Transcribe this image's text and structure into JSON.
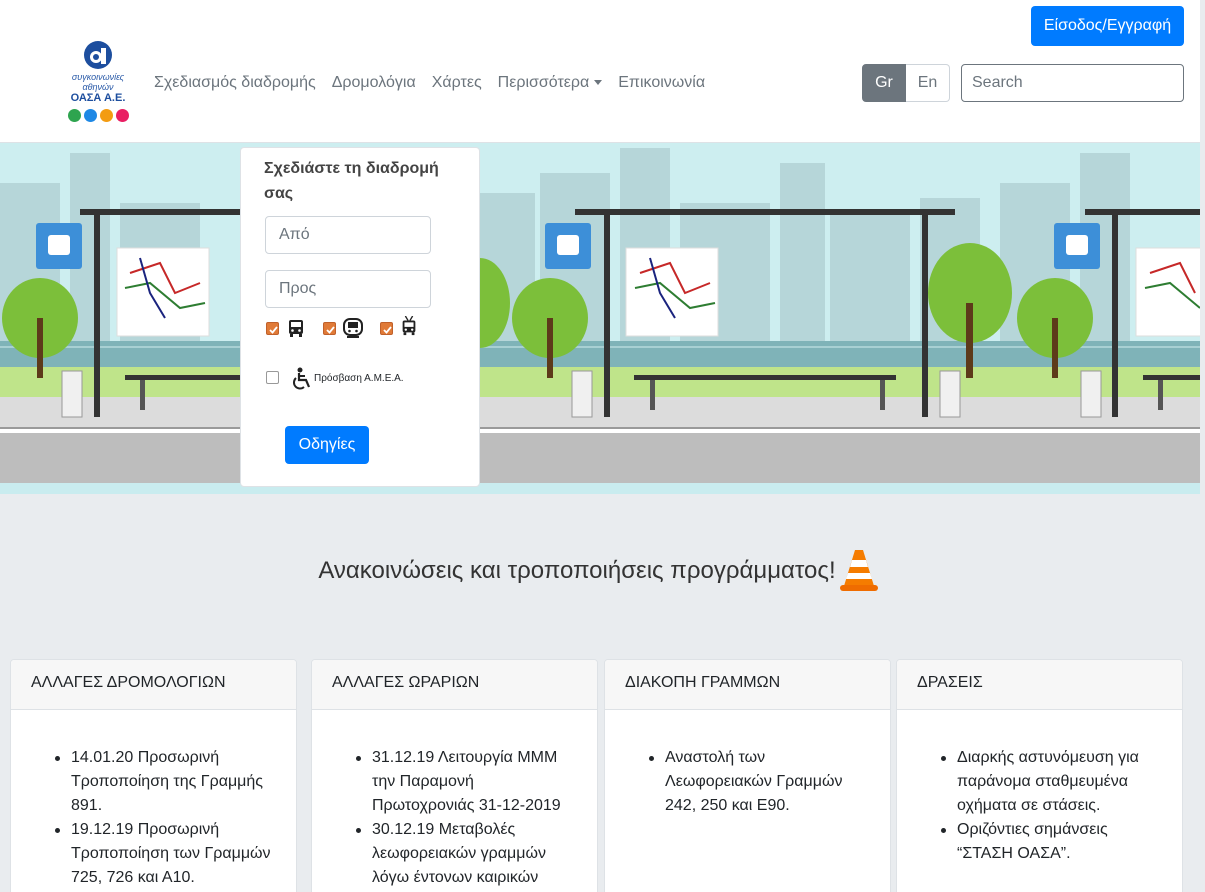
{
  "header": {
    "login_label": "Είσοδος/Εγγραφή",
    "logo": {
      "line1": "συγκοινωνίες",
      "line2": "αθηνών",
      "line3": "ΟΑΣΑ Α.Ε.",
      "dot_colors": [
        "#2ea44f",
        "#1e88e5",
        "#f39c12",
        "#e91e63"
      ]
    },
    "nav": [
      {
        "label": "Σχεδιασμός διαδρομής"
      },
      {
        "label": "Δρομολόγια"
      },
      {
        "label": "Χάρτες"
      },
      {
        "label": "Περισσότερα"
      },
      {
        "label": "Επικοινωνία"
      }
    ],
    "lang_gr": "Gr",
    "lang_en": "En",
    "search_placeholder": "Search"
  },
  "planner": {
    "title": "Σχεδιάστε τη διαδρομή σας",
    "from_placeholder": "Από",
    "to_placeholder": "Προς",
    "modes": [
      {
        "icon": "bus-icon",
        "checked": true
      },
      {
        "icon": "metro-icon",
        "checked": true
      },
      {
        "icon": "trolley-icon",
        "checked": true
      }
    ],
    "accessibility_label": "Πρόσβαση Α.Μ.Ε.Α.",
    "accessibility_checked": false,
    "directions_label": "Οδηγίες"
  },
  "announcements": {
    "title": "Ανακοινώσεις και τροποποιήσεις προγράμματος!",
    "cards": [
      {
        "heading": "ΑΛΛΑΓΕΣ ΔΡΟΜΟΛΟΓΙΩΝ",
        "items": [
          "14.01.20 Προσωρινή Τροποποίηση της Γραμμής 891.",
          "19.12.19 Προσωρινή Τροποποίηση των Γραμμών 725, 726 και Α10."
        ]
      },
      {
        "heading": "ΑΛΛΑΓΕΣ ΩΡΑΡΙΩΝ",
        "items": [
          "31.12.19 Λειτουργία ΜΜΜ την Παραμονή Πρωτοχρονιάς 31-12-2019",
          "30.12.19 Μεταβολές λεωφορειακών γραμμών λόγω έντονων καιρικών"
        ]
      },
      {
        "heading": "ΔΙΑΚΟΠΗ ΓΡΑΜΜΩΝ",
        "items": [
          "Αναστολή των Λεωφορειακών Γραμμών 242, 250 και Ε90."
        ]
      },
      {
        "heading": "ΔΡΑΣΕΙΣ",
        "items": [
          "Διαρκής αστυνόμευση για παράνομα σταθμευμένα οχήματα σε στάσεις.",
          "Οριζόντιες σημάνσεις “ΣΤΑΣΗ ΟΑΣΑ”."
        ]
      }
    ]
  },
  "colors": {
    "primary": "#007bff",
    "accent_orange": "#e07a37",
    "banner_sky": "#c9ecef"
  }
}
